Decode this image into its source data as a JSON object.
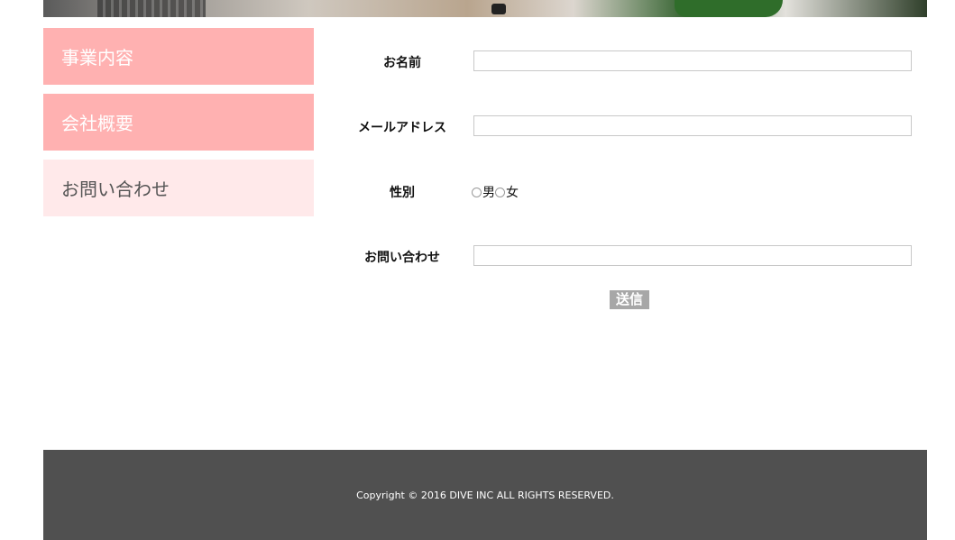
{
  "sidebar": {
    "items": [
      {
        "label": "事業内容"
      },
      {
        "label": "会社概要"
      },
      {
        "label": "お問い合わせ"
      }
    ]
  },
  "form": {
    "name_label": "お名前",
    "name_value": "",
    "email_label": "メールアドレス",
    "email_value": "",
    "gender_label": "性別",
    "gender_options": [
      "男",
      "女"
    ],
    "inquiry_label": "お問い合わせ",
    "inquiry_value": "",
    "submit_label": "送信"
  },
  "footer": {
    "copyright": "Copyright © 2016 DIVE INC ALL RIGHTS RESERVED."
  },
  "colors": {
    "nav_active": "#ffb1b1",
    "nav_current": "#ffe9ea",
    "footer_bg": "#505050",
    "submit_bg": "#a7a7a7"
  }
}
